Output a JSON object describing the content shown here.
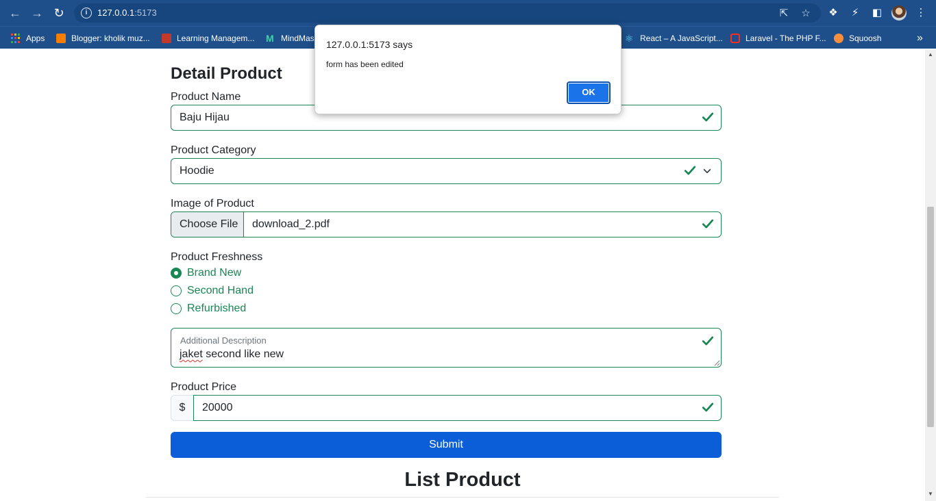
{
  "browser": {
    "url_host": "127.0.0.1",
    "url_port": ":5173",
    "bookmarks": [
      {
        "label": "Apps"
      },
      {
        "label": "Blogger: kholik muz..."
      },
      {
        "label": "Learning Managem..."
      },
      {
        "label": "MindMas"
      },
      {
        "label": "React – A JavaScript..."
      },
      {
        "label": "Laravel - The PHP F..."
      },
      {
        "label": "Squoosh"
      }
    ],
    "more_bookmarks": "»"
  },
  "dialog": {
    "title": "127.0.0.1:5173 says",
    "message": "form has been edited",
    "ok_label": "OK"
  },
  "form": {
    "heading": "Detail Product",
    "product_name_label": "Product Name",
    "product_name_value": "Baju Hijau",
    "category_label": "Product Category",
    "category_value": "Hoodie",
    "image_label": "Image of Product",
    "choose_file_label": "Choose File",
    "file_name": "download_2.pdf",
    "freshness_label": "Product Freshness",
    "freshness_options": [
      {
        "label": "Brand New",
        "checked": true
      },
      {
        "label": "Second Hand",
        "checked": false
      },
      {
        "label": "Refurbished",
        "checked": false
      }
    ],
    "description_label": "Additional Description",
    "description_first_word": "jaket",
    "description_rest": " second like new",
    "price_label": "Product Price",
    "price_prefix": "$",
    "price_value": "20000",
    "submit_label": "Submit"
  },
  "list": {
    "heading": "List Product"
  },
  "colors": {
    "valid_green": "#198754",
    "primary_blue": "#0b5ed7",
    "chrome_blue": "#1f4f8a"
  }
}
